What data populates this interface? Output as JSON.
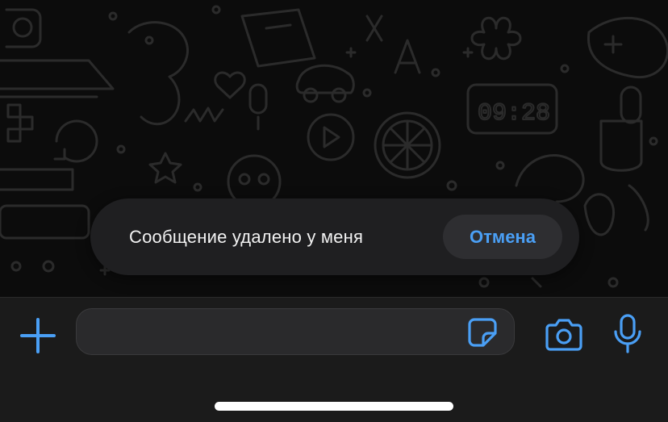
{
  "toast": {
    "message": "Сообщение удалено у меня",
    "undo_label": "Отмена"
  },
  "composer": {
    "message_value": "",
    "icons": {
      "attach": "plus-icon",
      "sticker": "sticker-icon",
      "camera": "camera-icon",
      "voice": "microphone-icon"
    }
  },
  "doodle_clock": "09:28",
  "colors": {
    "accent": "#4a9ff5",
    "background": "#0c0c0c",
    "toast_bg": "#1f1f21",
    "composer_bg": "#1b1b1b"
  }
}
